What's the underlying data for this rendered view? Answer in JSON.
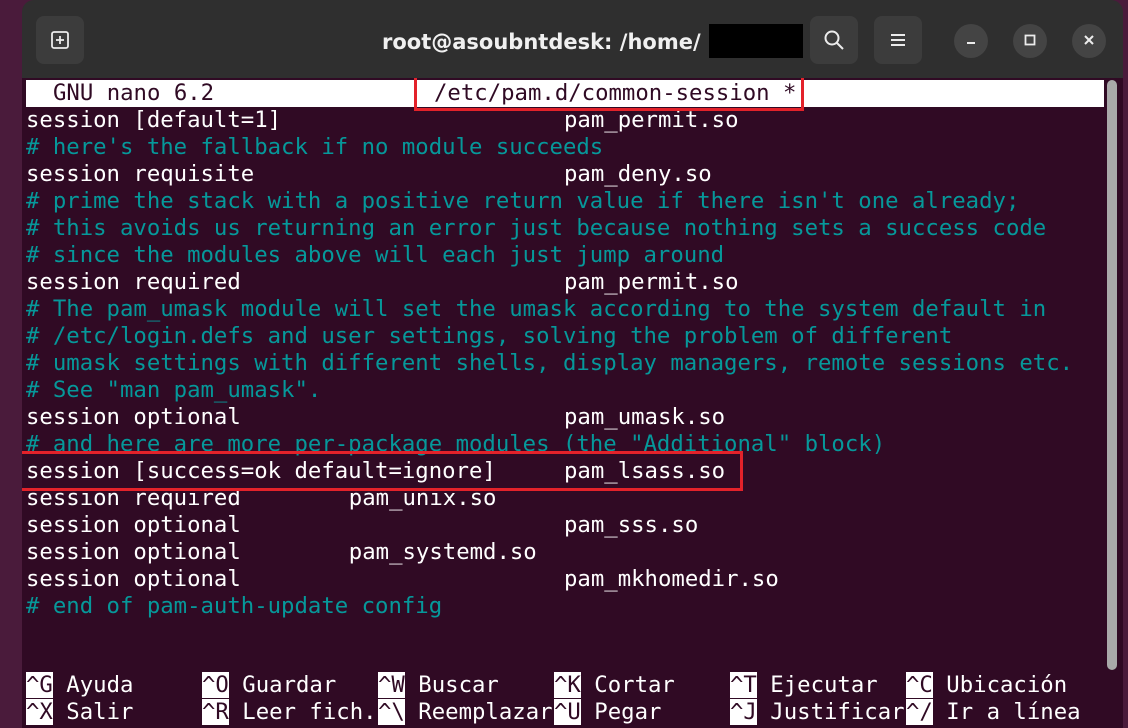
{
  "window": {
    "title": "root@asoubntdesk: /home/",
    "new_tab_icon": "new-tab-icon",
    "search_icon": "search-icon",
    "menu_icon": "hamburger-menu-icon",
    "minimize_icon": "minimize-icon",
    "maximize_icon": "maximize-icon",
    "close_icon": "close-icon"
  },
  "nano": {
    "version": "GNU nano 6.2",
    "filename": "/etc/pam.d/common-session *"
  },
  "lines": [
    {
      "a": "session [default=1]",
      "b": "pam_permit.so",
      "b_col": 40,
      "comment": false
    },
    {
      "a": "# here's the fallback if no module succeeds",
      "b": "",
      "b_col": 0,
      "comment": true
    },
    {
      "a": "session requisite",
      "b": "pam_deny.so",
      "b_col": 40,
      "comment": false
    },
    {
      "a": "# prime the stack with a positive return value if there isn't one already;",
      "b": "",
      "b_col": 0,
      "comment": true
    },
    {
      "a": "# this avoids us returning an error just because nothing sets a success code",
      "b": "",
      "b_col": 0,
      "comment": true
    },
    {
      "a": "# since the modules above will each just jump around",
      "b": "",
      "b_col": 0,
      "comment": true
    },
    {
      "a": "session required",
      "b": "pam_permit.so",
      "b_col": 40,
      "comment": false
    },
    {
      "a": "# The pam_umask module will set the umask according to the system default in",
      "b": "",
      "b_col": 0,
      "comment": true
    },
    {
      "a": "# /etc/login.defs and user settings, solving the problem of different",
      "b": "",
      "b_col": 0,
      "comment": true
    },
    {
      "a": "# umask settings with different shells, display managers, remote sessions etc.",
      "b": "",
      "b_col": 0,
      "comment": true
    },
    {
      "a": "# See \"man pam_umask\".",
      "b": "",
      "b_col": 0,
      "comment": true
    },
    {
      "a": "session optional",
      "b": "pam_umask.so",
      "b_col": 40,
      "comment": false
    },
    {
      "a": "# and here are more per-package modules (the \"Additional\" block)",
      "b": "",
      "b_col": 0,
      "comment": true
    },
    {
      "a": "session [success=ok default=ignore]",
      "b": "pam_lsass.so",
      "b_col": 40,
      "comment": false
    },
    {
      "a": "session required",
      "b": "pam_unix.so",
      "b_col": 24,
      "comment": false
    },
    {
      "a": "session optional",
      "b": "pam_sss.so",
      "b_col": 40,
      "comment": false
    },
    {
      "a": "session optional",
      "b": "pam_systemd.so",
      "b_col": 24,
      "comment": false
    },
    {
      "a": "session optional",
      "b": "pam_mkhomedir.so",
      "b_col": 40,
      "comment": false
    },
    {
      "a": "# end of pam-auth-update config",
      "b": "",
      "b_col": 0,
      "comment": true
    }
  ],
  "shortcuts": [
    [
      {
        "key": "^G",
        "label": "Ayuda"
      },
      {
        "key": "^O",
        "label": "Guardar"
      },
      {
        "key": "^W",
        "label": "Buscar"
      },
      {
        "key": "^K",
        "label": "Cortar"
      },
      {
        "key": "^T",
        "label": "Ejecutar"
      },
      {
        "key": "^C",
        "label": "Ubicación"
      }
    ],
    [
      {
        "key": "^X",
        "label": "Salir"
      },
      {
        "key": "^R",
        "label": "Leer fich."
      },
      {
        "key": "^\\",
        "label": "Reemplazar"
      },
      {
        "key": "^U",
        "label": "Pegar"
      },
      {
        "key": "^J",
        "label": "Justificar"
      },
      {
        "key": "^/",
        "label": "Ir a línea"
      }
    ]
  ],
  "colors": {
    "terminal_bg": "#300a24",
    "comment": "#06989a",
    "highlight_box": "#e3222a",
    "titlebar": "#2f2f2f"
  }
}
